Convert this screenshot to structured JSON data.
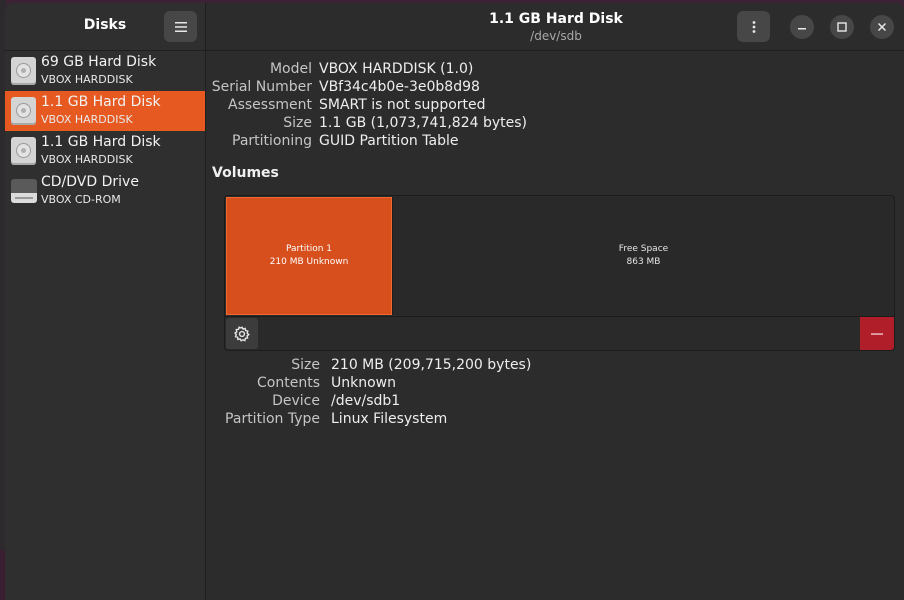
{
  "sidebar": {
    "title": "Disks",
    "disks": [
      {
        "name": "69 GB Hard Disk",
        "model": "VBOX HARDDISK",
        "type": "hdd-icon",
        "selected": false
      },
      {
        "name": "1.1 GB Hard Disk",
        "model": "VBOX HARDDISK",
        "type": "hdd-icon",
        "selected": true
      },
      {
        "name": "1.1 GB Hard Disk",
        "model": "VBOX HARDDISK",
        "type": "hdd-icon",
        "selected": false
      },
      {
        "name": "CD/DVD Drive",
        "model": "VBOX CD-ROM",
        "type": "optical-drive-icon",
        "selected": false
      }
    ]
  },
  "header": {
    "title": "1.1 GB Hard Disk",
    "subtitle": "/dev/sdb"
  },
  "disk_info": {
    "model_label": "Model",
    "model": "VBOX HARDDISK (1.0)",
    "serial_label": "Serial Number",
    "serial": "VBf34c4b0e-3e0b8d98",
    "assessment_label": "Assessment",
    "assessment": "SMART is not supported",
    "size_label": "Size",
    "size": "1.1 GB (1,073,741,824 bytes)",
    "partitioning_label": "Partitioning",
    "partitioning": "GUID Partition Table"
  },
  "volumes": {
    "title": "Volumes",
    "partition": {
      "name": "Partition 1",
      "desc": "210 MB Unknown"
    },
    "free_space": {
      "name": "Free Space",
      "size": "863 MB"
    }
  },
  "partition_info": {
    "size_label": "Size",
    "size": "210 MB (209,715,200 bytes)",
    "contents_label": "Contents",
    "contents": "Unknown",
    "device_label": "Device",
    "device": "/dev/sdb1",
    "type_label": "Partition Type",
    "type": "Linux Filesystem"
  },
  "colors": {
    "accent": "#e65a22",
    "partition": "#d64f1d",
    "destructive": "#b01e2a"
  }
}
